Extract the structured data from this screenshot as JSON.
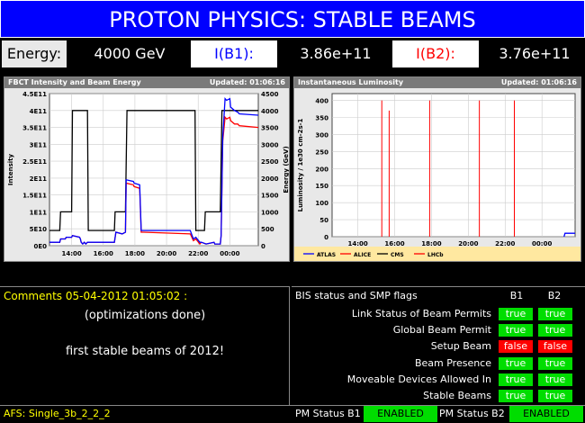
{
  "header": {
    "title": "PROTON PHYSICS: STABLE BEAMS"
  },
  "energy_row": {
    "energy_label": "Energy:",
    "energy_value": "4000 GeV",
    "ib1_label": "I(B1):",
    "ib1_value": "3.86e+11",
    "ib2_label": "I(B2):",
    "ib2_value": "3.76e+11"
  },
  "fbct_panel": {
    "title": "FBCT Intensity and Beam Energy",
    "updated": "Updated: 01:06:16",
    "chart_data": {
      "type": "line",
      "ylabel": "Intensity",
      "y2label": "Energy (GeV)",
      "xticks": [
        "14:00",
        "16:00",
        "18:00",
        "20:00",
        "22:00",
        "00:00"
      ],
      "yticks": [
        "0E0",
        "5E10",
        "1E11",
        "1.5E11",
        "2E11",
        "2.5E11",
        "3E11",
        "3.5E11",
        "4E11",
        "4.5E11"
      ],
      "y2ticks": [
        "0",
        "500",
        "1000",
        "1500",
        "2000",
        "2500",
        "3000",
        "3500",
        "4000",
        "4500"
      ],
      "xlim": [
        12.6,
        25.8
      ],
      "ylim": [
        0,
        450000000000.0
      ],
      "y2lim": [
        0,
        4500
      ],
      "series": [
        {
          "color": "#000000",
          "axis": "y2",
          "x": [
            12.6,
            13.25,
            13.3,
            14.0,
            14.05,
            14.5,
            14.55,
            15.0,
            15.05,
            16.7,
            16.75,
            17.4,
            17.5,
            18.0,
            18.05,
            21.8,
            21.85,
            22.4,
            22.45,
            23.4,
            23.5,
            24.0,
            24.05,
            24.5,
            24.55,
            25.8
          ],
          "values": [
            450,
            450,
            1000,
            1000,
            4000,
            4000,
            4000,
            4000,
            450,
            450,
            1000,
            1000,
            4000,
            4000,
            4000,
            4000,
            450,
            450,
            1000,
            1000,
            4000,
            4000,
            4000,
            4000,
            4000,
            4000
          ]
        },
        {
          "color": "#ff0000",
          "axis": "y",
          "x": [
            12.6,
            13.25,
            13.3,
            13.6,
            13.65,
            14.0,
            14.05,
            14.5,
            14.55,
            14.6,
            14.7,
            14.8,
            14.9,
            15.0,
            15.05,
            16.7,
            16.8,
            17.2,
            17.4,
            17.45,
            17.9,
            17.95,
            18.3,
            18.4,
            18.5,
            18.55,
            21.5,
            21.7,
            21.85,
            22.1,
            22.2,
            22.5,
            23.0,
            23.05,
            23.4,
            23.45,
            23.55,
            23.7,
            23.8,
            24.0,
            24.05,
            24.3,
            24.5,
            24.6,
            25.8
          ],
          "values": [
            10000000000.0,
            10000000000.0,
            20000000000.0,
            20000000000.0,
            25000000000.0,
            25000000000.0,
            30000000000.0,
            25000000000.0,
            20000000000.0,
            10000000000.0,
            5000000000.0,
            10000000000.0,
            5000000000.0,
            10000000000.0,
            10000000000.0,
            10000000000.0,
            40000000000.0,
            35000000000.0,
            40000000000.0,
            185000000000.0,
            180000000000.0,
            175000000000.0,
            170000000000.0,
            40000000000.0,
            40000000000.0,
            40000000000.0,
            35000000000.0,
            15000000000.0,
            20000000000.0,
            5000000000.0,
            10000000000.0,
            5000000000.0,
            10000000000.0,
            5000000000.0,
            5000000000.0,
            30000000000.0,
            310000000000.0,
            380000000000.0,
            375000000000.0,
            380000000000.0,
            370000000000.0,
            360000000000.0,
            360000000000.0,
            355000000000.0,
            350000000000.0
          ]
        },
        {
          "color": "#0000ff",
          "axis": "y",
          "x": [
            12.6,
            13.25,
            13.3,
            13.6,
            13.65,
            14.0,
            14.05,
            14.5,
            14.55,
            14.6,
            14.7,
            14.8,
            14.9,
            15.0,
            15.05,
            16.7,
            16.8,
            17.2,
            17.4,
            17.45,
            17.9,
            17.95,
            18.3,
            18.4,
            18.5,
            18.55,
            21.5,
            21.7,
            21.85,
            22.1,
            22.2,
            22.5,
            23.0,
            23.05,
            23.4,
            23.45,
            23.55,
            23.7,
            23.8,
            24.0,
            24.05,
            24.3,
            24.5,
            24.6,
            25.8
          ],
          "values": [
            10000000000.0,
            10000000000.0,
            20000000000.0,
            20000000000.0,
            25000000000.0,
            25000000000.0,
            30000000000.0,
            25000000000.0,
            20000000000.0,
            10000000000.0,
            5000000000.0,
            10000000000.0,
            5000000000.0,
            10000000000.0,
            10000000000.0,
            10000000000.0,
            40000000000.0,
            35000000000.0,
            40000000000.0,
            195000000000.0,
            190000000000.0,
            185000000000.0,
            180000000000.0,
            45000000000.0,
            45000000000.0,
            45000000000.0,
            45000000000.0,
            20000000000.0,
            25000000000.0,
            10000000000.0,
            10000000000.0,
            5000000000.0,
            10000000000.0,
            5000000000.0,
            5000000000.0,
            30000000000.0,
            320000000000.0,
            435000000000.0,
            430000000000.0,
            435000000000.0,
            410000000000.0,
            400000000000.0,
            395000000000.0,
            390000000000.0,
            386000000000.0
          ]
        }
      ]
    }
  },
  "lumi_panel": {
    "title": "Instantaneous Luminosity",
    "updated": "Updated: 01:06:16",
    "chart_data": {
      "type": "line",
      "ylabel": "Luminosity / 1e30 cm-2s-1",
      "xticks": [
        "14:00",
        "16:00",
        "18:00",
        "20:00",
        "22:00",
        "00:00"
      ],
      "yticks": [
        "0",
        "50",
        "100",
        "150",
        "200",
        "250",
        "300",
        "350",
        "400"
      ],
      "xlim": [
        12.6,
        25.8
      ],
      "ylim": [
        0,
        420
      ],
      "legend": [
        "ATLAS",
        "ALICE",
        "CMS",
        "LHCb"
      ],
      "legend_colors": [
        "#0000ff",
        "#ff0000",
        "#000000",
        "#ff0000"
      ],
      "spikes_x": [
        15.3,
        15.7,
        17.9,
        20.6,
        22.5
      ],
      "spikes_y": [
        400,
        370,
        400,
        400,
        400
      ],
      "tail_x": [
        25.2,
        25.25,
        25.8
      ],
      "tail_y": [
        0,
        10,
        10
      ]
    }
  },
  "comments": {
    "header": "Comments 05-04-2012 01:05:02 :",
    "line1": "(optimizations done)",
    "line2": "first stable beams of 2012!"
  },
  "flags": {
    "header": "BIS status and SMP flags",
    "col_b1": "B1",
    "col_b2": "B2",
    "items": [
      {
        "label": "Link Status of Beam Permits",
        "b1": "true",
        "b2": "true"
      },
      {
        "label": "Global Beam Permit",
        "b1": "true",
        "b2": "true"
      },
      {
        "label": "Setup Beam",
        "b1": "false",
        "b2": "false"
      },
      {
        "label": "Beam Presence",
        "b1": "true",
        "b2": "true"
      },
      {
        "label": "Moveable Devices Allowed In",
        "b1": "true",
        "b2": "true"
      },
      {
        "label": "Stable Beams",
        "b1": "true",
        "b2": "true"
      }
    ]
  },
  "footer": {
    "afs": "AFS: Single_3b_2_2_2",
    "pm_b1_label": "PM Status B1",
    "pm_b1_value": "ENABLED",
    "pm_b2_label": "PM Status B2",
    "pm_b2_value": "ENABLED"
  },
  "colors": {
    "title_bg": "#0000ff",
    "label_blue": "#0000ff",
    "label_red": "#ff0000",
    "status_green": "#00dd00",
    "status_red": "#ff0000",
    "comment_yellow": "#ffff00"
  }
}
